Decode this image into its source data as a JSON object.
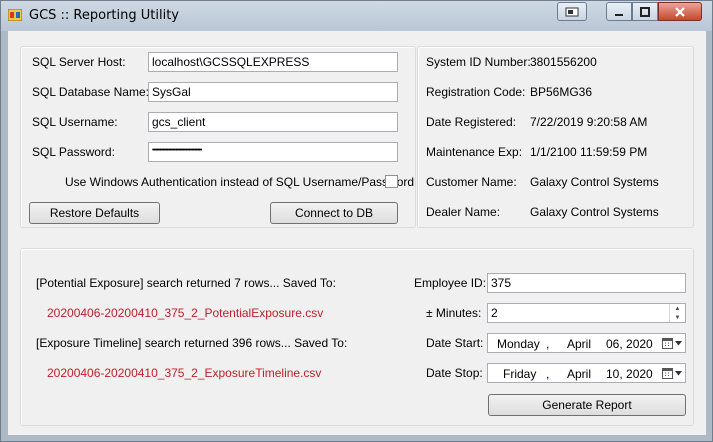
{
  "window": {
    "title": "GCS :: Reporting Utility"
  },
  "connection": {
    "server_host_label": "SQL Server Host:",
    "server_host_value": "localhost\\GCSSQLEXPRESS",
    "database_label": "SQL Database Name:",
    "database_value": "SysGal",
    "username_label": "SQL Username:",
    "username_value": "gcs_client",
    "password_label": "SQL Password:",
    "password_value": "••••••••••••••••••••••••••••••••••",
    "windows_auth_label": "Use Windows Authentication instead of SQL Username/Password",
    "windows_auth_checked": false,
    "restore_defaults_label": "Restore Defaults",
    "connect_label": "Connect to DB"
  },
  "system_info": {
    "system_id_label": "System ID Number:",
    "system_id_value": "3801556200",
    "registration_label": "Registration Code:",
    "registration_value": "BP56MG36",
    "date_registered_label": "Date Registered:",
    "date_registered_value": "7/22/2019 9:20:58 AM",
    "maintenance_label": "Maintenance Exp:",
    "maintenance_value": "1/1/2100 11:59:59 PM",
    "customer_label": "Customer Name:",
    "customer_value": "Galaxy Control Systems",
    "dealer_label": "Dealer Name:",
    "dealer_value": "Galaxy Control Systems"
  },
  "results": {
    "potential_msg": "[Potential Exposure] search returned 7 rows...  Saved To:",
    "potential_file": "20200406-20200410_375_2_PotentialExposure.csv",
    "timeline_msg": "[Exposure Timeline] search returned 396 rows...  Saved To:",
    "timeline_file": "20200406-20200410_375_2_ExposureTimeline.csv"
  },
  "report": {
    "employee_label": "Employee ID:",
    "employee_value": "375",
    "minutes_label": "± Minutes:",
    "minutes_value": "2",
    "date_start_label": "Date Start:",
    "date_start": {
      "weekday": "Monday",
      "sep": ",",
      "month": "April",
      "day_year": "06, 2020"
    },
    "date_stop_label": "Date Stop:",
    "date_stop": {
      "weekday": "Friday",
      "sep": ",",
      "month": "April",
      "day_year": "10, 2020"
    },
    "generate_label": "Generate Report"
  },
  "icons": {
    "app": "app-icon",
    "caption_extra": "restore-window-icon",
    "minimize": "minimize-icon",
    "maximize": "maximize-icon",
    "close": "close-icon",
    "calendar": "calendar-icon",
    "dropdown": "chevron-down-icon",
    "spin_up": "spin-up-icon",
    "spin_down": "spin-down-icon"
  },
  "colors": {
    "file_link": "#c0202a",
    "close_button": "#c6472e",
    "client_bg": "#f0f0f0"
  }
}
